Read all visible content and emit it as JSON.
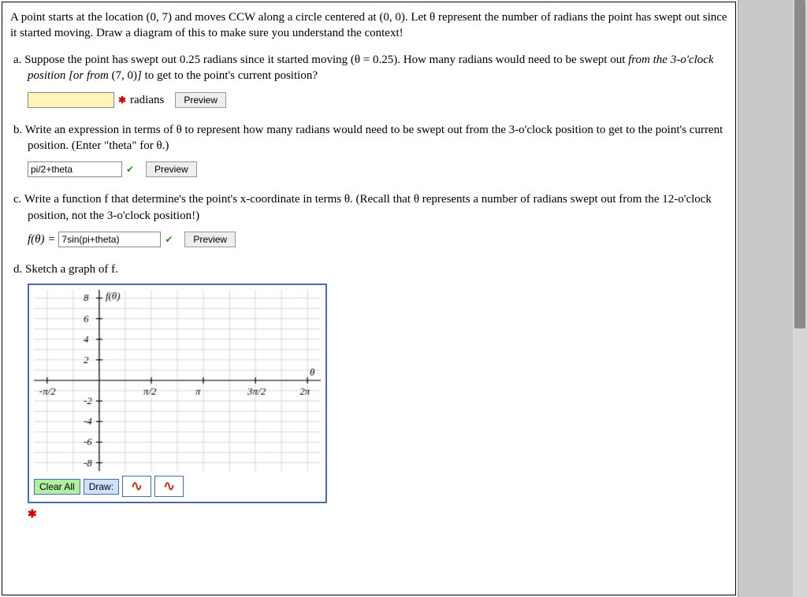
{
  "intro": "A point starts at the location (0, 7) and moves CCW along a circle centered at (0, 0). Let θ represent the number of radians the point has swept out since it started moving. Draw a diagram of this to make sure you understand the context!",
  "partA": {
    "label": "a.",
    "text1": "Suppose the point has swept out 0.25 radians since it started moving (θ = 0.25). How many radians would need to be swept out ",
    "italic1": "from the 3-o'clock position [or from ",
    "text2": "(7, 0)",
    "italic2": "] ",
    "text3": "to get to the point's current position?",
    "value": "",
    "unit": "radians",
    "mark": "✱",
    "preview": "Preview"
  },
  "partB": {
    "label": "b.",
    "text": "Write an expression in terms of θ to represent how many radians would need to be swept out from the 3-o'clock position to get to the point's current position. (Enter \"theta\" for θ.)",
    "value": "pi/2+theta",
    "mark": "✔",
    "preview": "Preview"
  },
  "partC": {
    "label": "c.",
    "text": "Write a function f that determine's the point's x-coordinate in terms θ. (Recall that θ represents a number of radians swept out from the 12-o'clock position, not the 3-o'clock position!)",
    "prefix": "f(θ) = ",
    "value": "7sin(pi+theta)",
    "mark": "✔",
    "preview": "Preview"
  },
  "partD": {
    "label": "d.",
    "text": "Sketch a graph of f.",
    "clear": "Clear All",
    "draw": "Draw:",
    "badmark": "✱"
  },
  "graph": {
    "yTicks": [
      8,
      6,
      4,
      2,
      -2,
      -4,
      -6,
      -8
    ],
    "xTicks": [
      "-π/2",
      "π/2",
      "π",
      "3π/2",
      "2π"
    ],
    "yLabel": "f(θ)",
    "xLabel": "θ"
  }
}
